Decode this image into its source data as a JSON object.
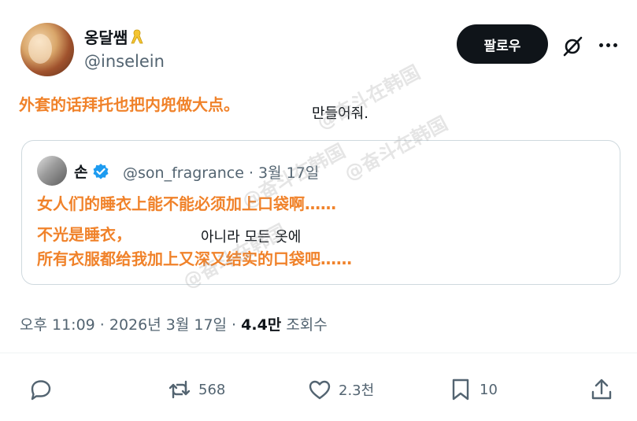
{
  "author": {
    "display_name": "옹달쌤",
    "handle": "@inselein"
  },
  "follow_button": "팔로우",
  "post": {
    "overlay_text": "外套的话拜托也把内兜做大点。",
    "original_visible": "만들어줘."
  },
  "quote": {
    "name": "손",
    "handle_date": "@son_fragrance · 3월 17일",
    "line1_overlay": "女人们的睡衣上能不能必须加上口袋啊……",
    "line2_overlay": "不光是睡衣，",
    "line2_original": "아니라 모든 옷에",
    "line3_overlay": "所有衣服都给我加上又深又结实的口袋吧……"
  },
  "watermark": "@奋斗在韩国",
  "meta": {
    "time_date": "오후 11:09 · 2026년 3월 17일 · ",
    "views": "4.4만",
    "views_label": " 조회수"
  },
  "actions": {
    "reply": "",
    "retweet": "568",
    "like": "2.3천",
    "bookmark": "10"
  },
  "colors": {
    "overlay_text": "#f0822a",
    "verified": "#1d9bf0",
    "ribbon": "#f4c430",
    "follow_bg": "#0f1419"
  }
}
